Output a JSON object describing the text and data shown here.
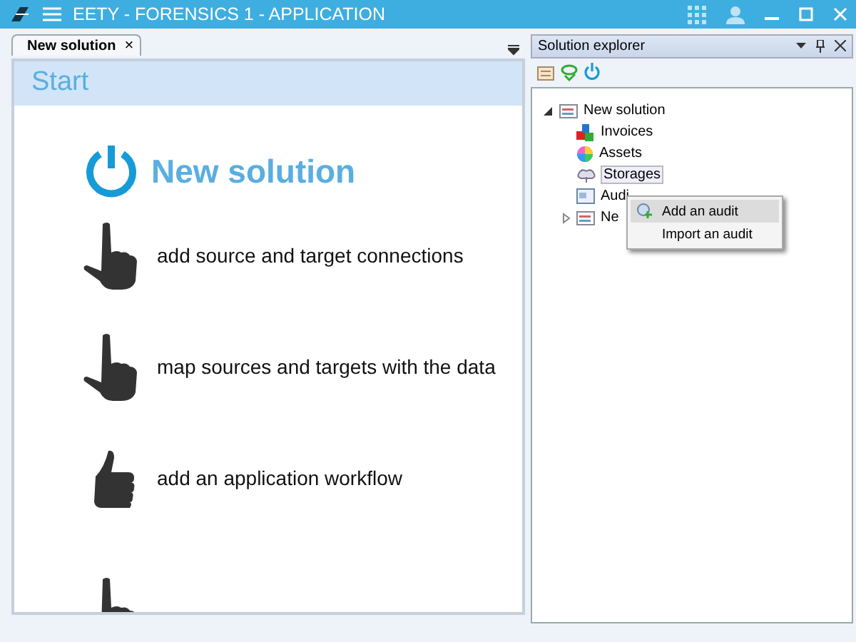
{
  "window": {
    "title": "EETY - FORENSICS 1 - APPLICATION"
  },
  "tabs": [
    {
      "label": "New solution",
      "close": "×",
      "selected": true
    }
  ],
  "start": {
    "header": "Start",
    "title": "New solution",
    "steps": [
      {
        "kind": "pointing",
        "label": "add source and target connections"
      },
      {
        "kind": "pointing",
        "label": "map sources and targets with the data"
      },
      {
        "kind": "thumb",
        "label": "add an application workflow"
      },
      {
        "kind": "partial"
      }
    ]
  },
  "explorer": {
    "title": "Solution explorer",
    "tree": [
      {
        "label": "New solution",
        "kind": "solution",
        "expanded": true,
        "selected": false,
        "children": [
          {
            "label": "Invoices",
            "kind": "blocks",
            "selected": false
          },
          {
            "label": "Assets",
            "kind": "wheel",
            "selected": false
          },
          {
            "label": "Storages",
            "kind": "cloud",
            "selected": true
          },
          {
            "label": "Audi",
            "kind": "audit",
            "selected": false
          },
          {
            "label": "Ne",
            "kind": "solution",
            "expanded": false,
            "selected": false
          }
        ]
      }
    ]
  },
  "context_menu": [
    {
      "label": "Add an audit",
      "selected": true
    },
    {
      "label": "Import an audit",
      "selected": false
    }
  ]
}
